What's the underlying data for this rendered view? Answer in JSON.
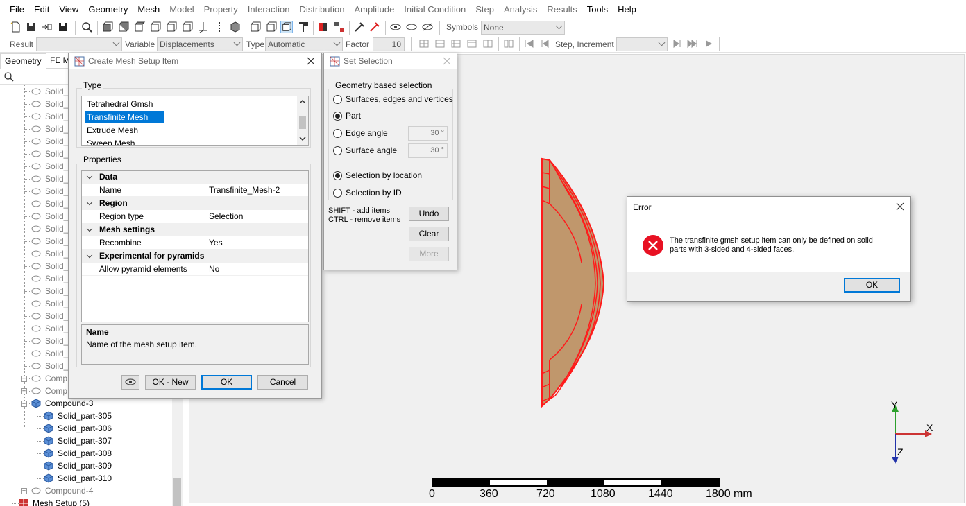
{
  "menubar": {
    "items": [
      {
        "label": "File",
        "enabled": true
      },
      {
        "label": "Edit",
        "enabled": true
      },
      {
        "label": "View",
        "enabled": true
      },
      {
        "label": "Geometry",
        "enabled": true
      },
      {
        "label": "Mesh",
        "enabled": true
      },
      {
        "label": "Model",
        "enabled": false
      },
      {
        "label": "Property",
        "enabled": false
      },
      {
        "label": "Interaction",
        "enabled": false
      },
      {
        "label": "Distribution",
        "enabled": false
      },
      {
        "label": "Amplitude",
        "enabled": false
      },
      {
        "label": "Initial Condition",
        "enabled": false
      },
      {
        "label": "Step",
        "enabled": false
      },
      {
        "label": "Analysis",
        "enabled": false
      },
      {
        "label": "Results",
        "enabled": false
      },
      {
        "label": "Tools",
        "enabled": true
      },
      {
        "label": "Help",
        "enabled": true
      }
    ]
  },
  "toolbar1": {
    "symbols_label": "Symbols",
    "symbols_value": "None"
  },
  "toolbar2": {
    "result_label": "Result",
    "result_value": "",
    "variable_label": "Variable",
    "variable_value": "Displacements",
    "type_label": "Type",
    "type_value": "Automatic",
    "factor_label": "Factor",
    "factor_value": "10",
    "step_label": "Step, Increment",
    "step_value": ""
  },
  "left_panel": {
    "tabs": [
      "Geometry",
      "FE M"
    ],
    "tree_dim_items": [
      "Solid_p",
      "Solid_p",
      "Solid_p",
      "Solid_p",
      "Solid_p",
      "Solid_p",
      "Solid_p",
      "Solid_p",
      "Solid_p",
      "Solid_p",
      "Solid_p",
      "Solid_p",
      "Solid_p",
      "Solid_p",
      "Solid_p",
      "Solid_p",
      "Solid_p",
      "Solid_p",
      "Solid_p",
      "Solid_p",
      "Solid_p",
      "Solid_p",
      "Solid_p"
    ],
    "compound_collapsed": [
      "Comp",
      "Comp"
    ],
    "compound3": "Compound-3",
    "compound3_children": [
      "Solid_part-305",
      "Solid_part-306",
      "Solid_part-307",
      "Solid_part-308",
      "Solid_part-309",
      "Solid_part-310"
    ],
    "compound4": "Compound-4",
    "mesh_setup": "Mesh Setup (5)"
  },
  "create_dialog": {
    "title": "Create Mesh Setup Item",
    "type_label": "Type",
    "type_items": [
      "Tetrahedral Gmsh",
      "Transfinite Mesh",
      "Extrude Mesh",
      "Sweep Mesh"
    ],
    "selected_index": 1,
    "properties_label": "Properties",
    "props": [
      {
        "kind": "hdr",
        "name": "Data"
      },
      {
        "kind": "val",
        "name": "Name",
        "value": "Transfinite_Mesh-2"
      },
      {
        "kind": "hdr",
        "name": "Region"
      },
      {
        "kind": "val",
        "name": "Region type",
        "value": "Selection"
      },
      {
        "kind": "hdr",
        "name": "Mesh settings"
      },
      {
        "kind": "val",
        "name": "Recombine",
        "value": "Yes"
      },
      {
        "kind": "hdr",
        "name": "Experimental for pyramids"
      },
      {
        "kind": "val",
        "name": "Allow pyramid elements",
        "value": "No"
      }
    ],
    "desc_title": "Name",
    "desc_text": "Name of the mesh setup item.",
    "btn_ok_new": "OK - New",
    "btn_ok": "OK",
    "btn_cancel": "Cancel"
  },
  "set_selection": {
    "title": "Set Selection",
    "group_label": "Geometry based selection",
    "opt_surfaces": "Surfaces, edges and vertices",
    "opt_part": "Part",
    "opt_edge": "Edge angle",
    "edge_value": "30 °",
    "opt_surface": "Surface angle",
    "surface_value": "30 °",
    "opt_location": "Selection by location",
    "opt_id": "Selection by ID",
    "hint1": "SHIFT - add items",
    "hint2": "CTRL - remove items",
    "btn_undo": "Undo",
    "btn_clear": "Clear",
    "btn_more": "More"
  },
  "error_dialog": {
    "title": "Error",
    "message_line1": "The transfinite gmsh setup item can only be defined on solid",
    "message_line2": "parts with 3-sided and 4-sided faces.",
    "btn_ok": "OK"
  },
  "axes": {
    "y": "Y",
    "x": "X",
    "z": "Z"
  },
  "scale": {
    "ticks": [
      "0",
      "360",
      "720",
      "1080",
      "1440",
      "1800 mm"
    ]
  },
  "colors": {
    "accent": "#0078d7",
    "part_red": "#ff1a1a",
    "part_fill": "#b89068",
    "error_red": "#e81123"
  }
}
